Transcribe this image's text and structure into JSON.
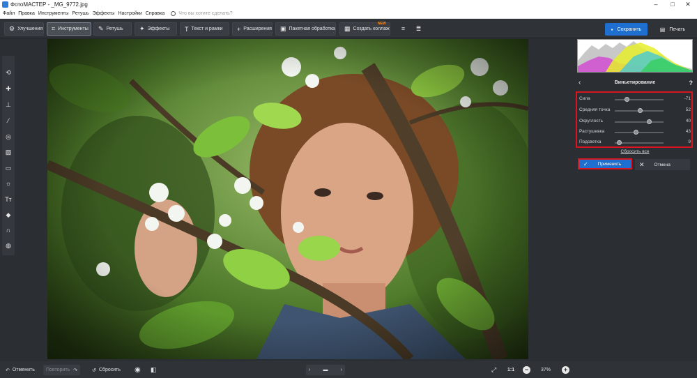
{
  "window": {
    "title": "ФотоМАСТЕР - _MG_9772.jpg",
    "min_icon": "minimize-icon",
    "max_icon": "maximize-icon",
    "close_icon": "close-icon"
  },
  "menu": {
    "items": [
      "Файл",
      "Правка",
      "Инструменты",
      "Ретушь",
      "Эффекты",
      "Настройки",
      "Справка"
    ],
    "search_placeholder": "Что вы хотите сделать?"
  },
  "toolbar": {
    "tabs": [
      {
        "label": "Улучшения",
        "icon": "enhance-icon"
      },
      {
        "label": "Инструменты",
        "icon": "crop-icon",
        "active": true
      },
      {
        "label": "Ретушь",
        "icon": "brush-icon"
      },
      {
        "label": "Эффекты",
        "icon": "sparkle-icon"
      },
      {
        "label": "Текст и рамки",
        "icon": "text-icon"
      },
      {
        "label": "Расширения",
        "icon": "plus-icon"
      },
      {
        "label": "Пакетная обработка",
        "icon": "batch-icon"
      },
      {
        "label": "Создать коллаж",
        "icon": "collage-icon"
      }
    ],
    "new_badge": "NEW",
    "save_label": "Сохранить",
    "print_label": "Печать"
  },
  "left_tools": [
    "rotate-icon",
    "healing-icon",
    "stamp-icon",
    "brush-icon",
    "target-icon",
    "gradient-icon",
    "vignette-icon",
    "light-icon",
    "text-icon",
    "fill-icon",
    "magnet-icon",
    "globe-icon"
  ],
  "panel": {
    "title": "Виньетирование",
    "sliders": [
      {
        "label": "Сила",
        "value": "-71",
        "pos": 0.24
      },
      {
        "label": "Средняя точка",
        "value": "52",
        "pos": 0.52
      },
      {
        "label": "Округлость",
        "value": "40",
        "pos": 0.7
      },
      {
        "label": "Растушевка",
        "value": "43",
        "pos": 0.43
      },
      {
        "label": "Подсветка",
        "value": "9",
        "pos": 0.09
      }
    ],
    "reset_label": "Сбросить все",
    "apply_label": "Применить",
    "cancel_label": "Отмена"
  },
  "bottom": {
    "undo": "Отменить",
    "redo": "Повторить",
    "reset": "Сбросить",
    "zoom_ratio": "1:1",
    "zoom": "37%"
  },
  "colors": {
    "accent": "#1f6fd1",
    "highlight": "#d71620"
  }
}
